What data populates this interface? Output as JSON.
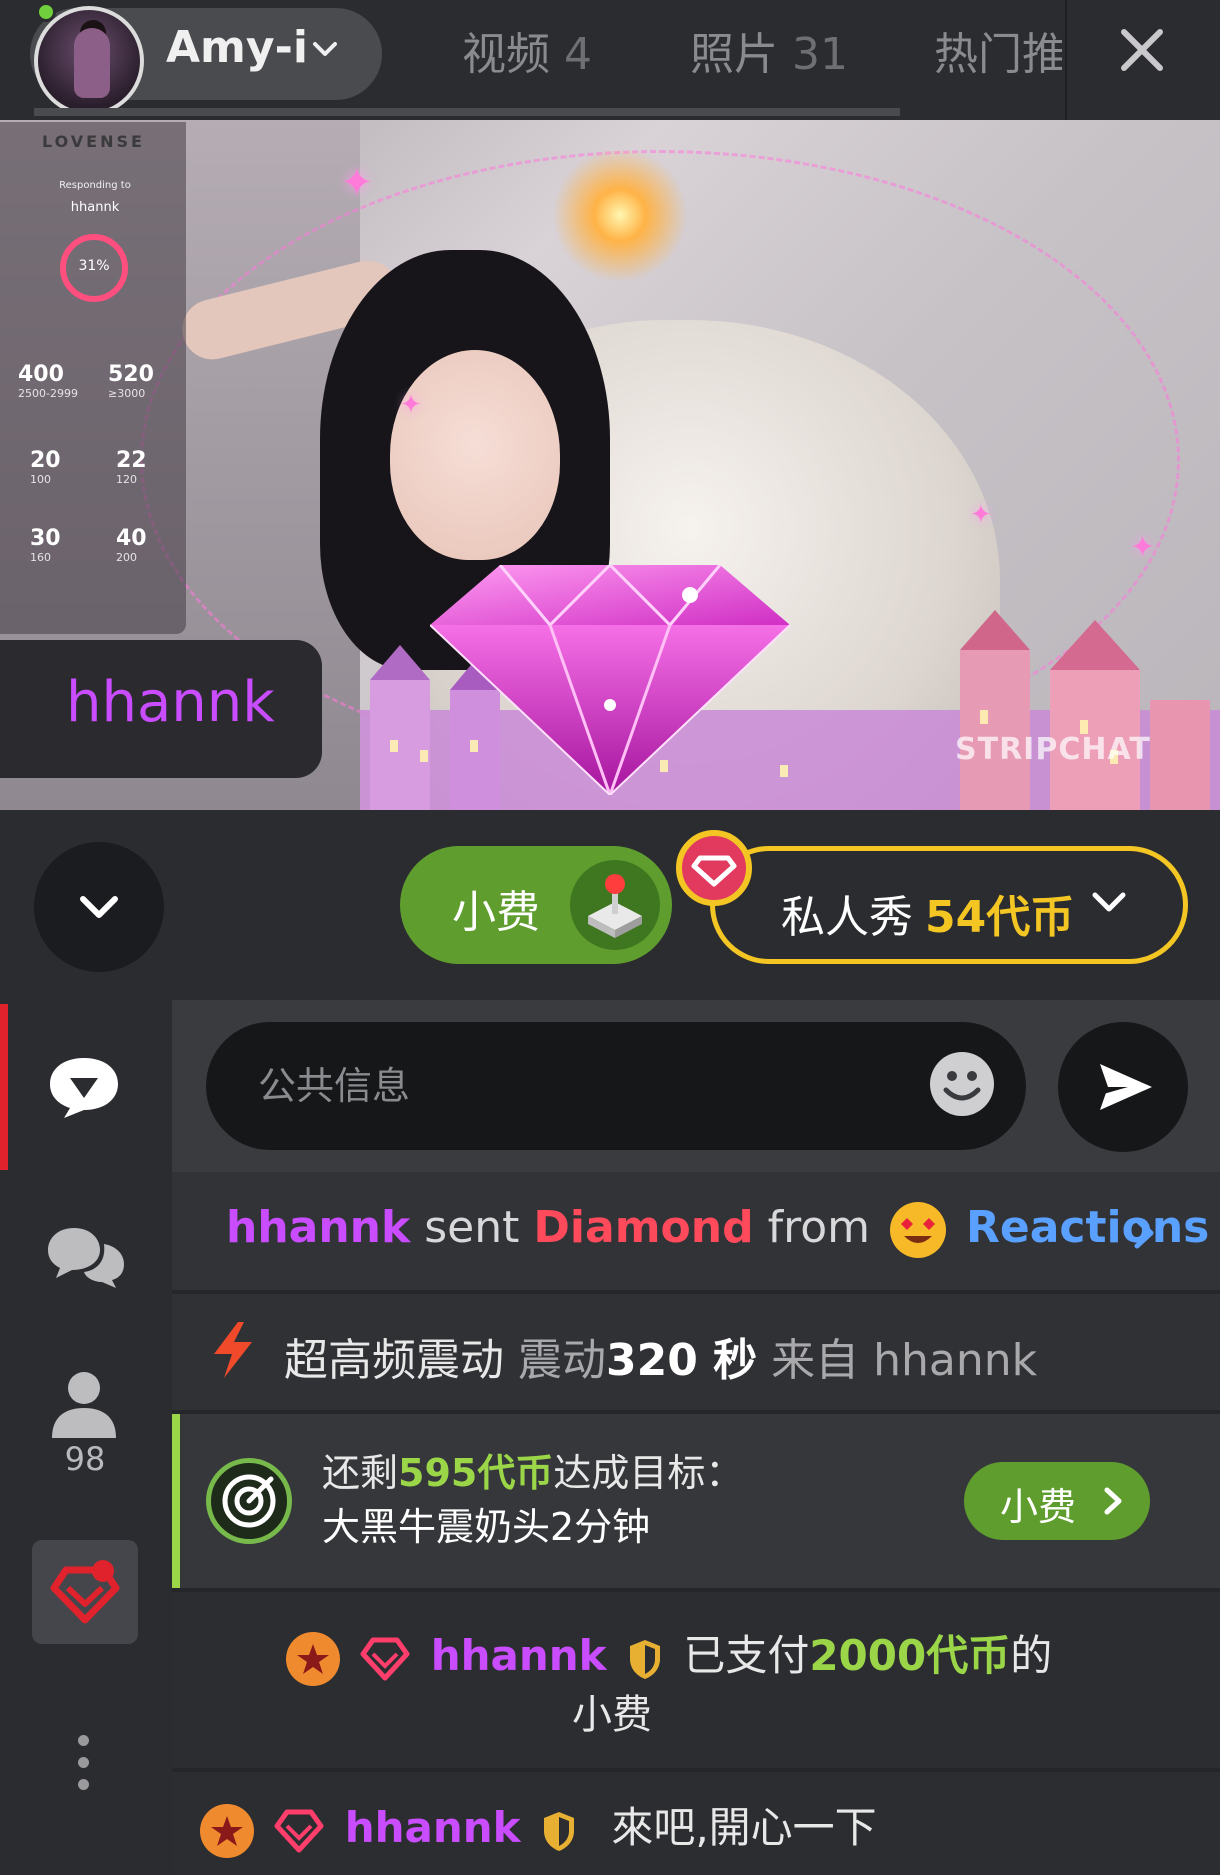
{
  "header": {
    "model_name": "Amy-i",
    "tabs": [
      {
        "label": "视频",
        "count": "4"
      },
      {
        "label": "照片",
        "count": "31"
      },
      {
        "label": "热门推",
        "count": ""
      }
    ]
  },
  "video": {
    "lovense": {
      "logo": "LOVENSE",
      "small_text": "Responding to",
      "user": "hhannk",
      "ring_value": "31%",
      "levels": [
        {
          "value": "400",
          "range": "2500-2999"
        },
        {
          "value": "520",
          "range": "≥3000"
        },
        {
          "value": "20",
          "range": "100"
        },
        {
          "value": "22",
          "range": "120"
        },
        {
          "value": "30",
          "range": "160"
        },
        {
          "value": "40",
          "range": "200"
        }
      ]
    },
    "watermark": "STRIPCHAT",
    "sender_name": "hhannk"
  },
  "actions": {
    "tip_label": "小费",
    "private_label": "私人秀",
    "private_price": "54代币"
  },
  "sidebar": {
    "users_count": "98"
  },
  "chat": {
    "input_placeholder": "公共信息",
    "reaction": {
      "user": "hhannk",
      "sent": "sent",
      "item": "Diamond",
      "from": "from",
      "source": "Reactions"
    },
    "vibration": {
      "level": "超高频震动",
      "label": "震动",
      "duration": "320 秒",
      "from": "来自 hhannk"
    },
    "goal": {
      "prefix": "还剩",
      "amount": "595代币",
      "suffix": "达成目标：",
      "text": "大黑牛震奶头2分钟",
      "tip_label": "小费"
    },
    "tip_message": {
      "user": "hhannk",
      "prefix": "已支付",
      "amount": "2000代币",
      "suffix": "的",
      "line2": "小费"
    },
    "last_message": {
      "user": "hhannk",
      "text": "來吧,開心一下"
    }
  },
  "colors": {
    "accent_green": "#5f9e2e",
    "accent_yellow": "#f3c624",
    "username_purple": "#c94dff",
    "live_red": "#e0222d"
  }
}
